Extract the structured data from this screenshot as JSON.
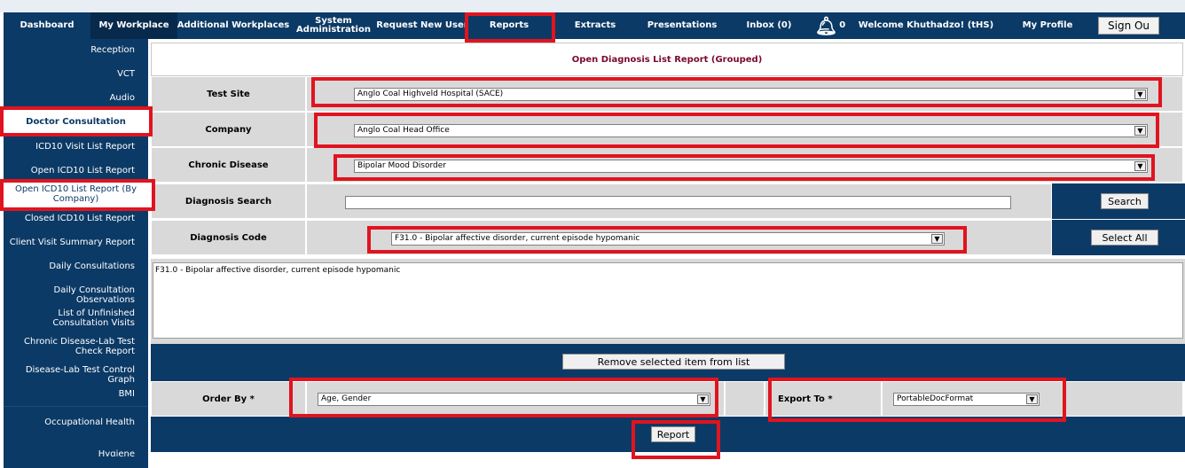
{
  "nav": {
    "dashboard": "Dashboard",
    "my_workplace": "My Workplace",
    "additional_workplaces": "Additional Workplaces",
    "system_admin_line1": "System",
    "system_admin_line2": "Administration",
    "request_new_user": "Request New User",
    "reports": "Reports",
    "extracts": "Extracts",
    "presentations": "Presentations",
    "inbox": "Inbox (0)",
    "notification_count": "0",
    "welcome": "Welcome Khuthadzo! (tHS)",
    "my_profile": "My Profile",
    "sign_out": "Sign Ou"
  },
  "sidebar": {
    "items": [
      "Reception",
      "VCT",
      "Audio",
      "Doctor Consultation",
      "ICD10 Visit  List Report",
      "Open ICD10 List Report",
      "Open ICD10 List Report (By Company)",
      "Closed ICD10 List Report",
      "Client Visit Summary Report",
      "Daily Consultations",
      "Daily Consultation Observations",
      "List of Unfinished Consultation Visits",
      "Chronic Disease-Lab Test Check Report",
      "Disease-Lab Test Control Graph",
      "BMI",
      "Occupational Health",
      "Hygiene"
    ]
  },
  "main": {
    "title": "Open Diagnosis List Report (Grouped)",
    "test_site_label": "Test Site",
    "test_site_value": "Anglo Coal Highveld Hospital (SACE)",
    "company_label": "Company",
    "company_value": "Anglo Coal Head Office",
    "chronic_disease_label": "Chronic Disease",
    "chronic_disease_value": "Bipolar Mood Disorder",
    "diagnosis_search_label": "Diagnosis Search",
    "diagnosis_search_value": "",
    "search_button": "Search",
    "diagnosis_code_label": "Diagnosis Code",
    "diagnosis_code_value": "F31.0 - Bipolar affective disorder, current episode hypomanic",
    "select_all_button": "Select All",
    "selected_list_item": "F31.0 - Bipolar affective disorder, current episode hypomanic",
    "remove_button": "Remove selected item from list",
    "order_by_label": "Order By *",
    "order_by_value": "Age, Gender",
    "export_to_label": "Export To *",
    "export_to_value": "PortableDocFormat",
    "report_button": "Report"
  },
  "colors": {
    "nav_bg": "#0c3a66",
    "highlight": "#e0141f",
    "title_text": "#7a0a2b",
    "cell_bg": "#d9d9d9"
  }
}
